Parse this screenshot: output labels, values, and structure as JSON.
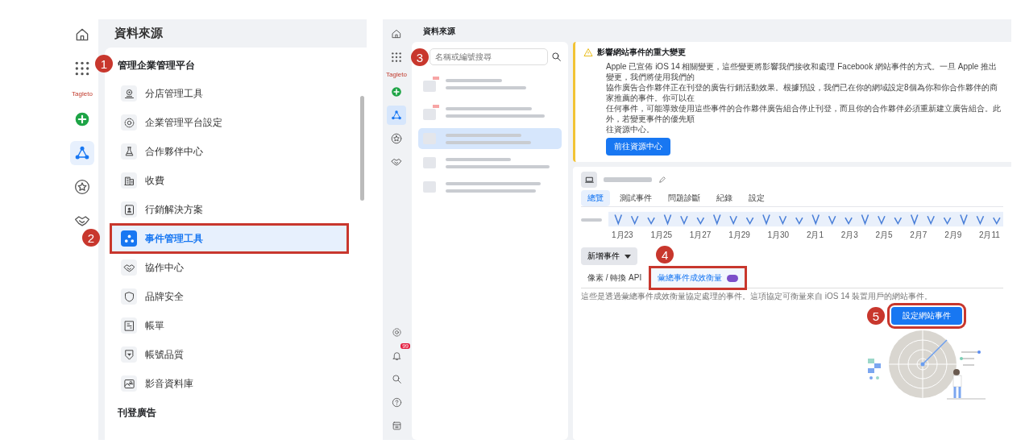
{
  "left_screenshot": {
    "title": "資料來源",
    "rail": [
      {
        "kind": "icon",
        "selected": false
      },
      {
        "kind": "icon",
        "selected": false
      },
      {
        "kind": "logo",
        "text": "Tagleto"
      },
      {
        "kind": "icon",
        "selected": false
      },
      {
        "kind": "icon",
        "selected": true
      },
      {
        "kind": "icon",
        "selected": false
      },
      {
        "kind": "icon",
        "selected": false
      }
    ],
    "menu": {
      "heading": "管理企業管理平台",
      "heading_marker": "1",
      "items": [
        {
          "label": "分店管理工具",
          "selected": false,
          "highlighted": false
        },
        {
          "label": "企業管理平台設定",
          "selected": false,
          "highlighted": false
        },
        {
          "label": "合作夥伴中心",
          "selected": false,
          "highlighted": false
        },
        {
          "label": "收費",
          "selected": false,
          "highlighted": false
        },
        {
          "label": "行銷解決方案",
          "selected": false,
          "highlighted": false
        },
        {
          "label": "事件管理工具",
          "selected": true,
          "highlighted": true,
          "marker": "2"
        },
        {
          "label": "協作中心",
          "selected": false,
          "highlighted": false
        },
        {
          "label": "品牌安全",
          "selected": false,
          "highlighted": false
        },
        {
          "label": "帳單",
          "selected": false,
          "highlighted": false
        },
        {
          "label": "帳號品質",
          "selected": false,
          "highlighted": false
        },
        {
          "label": "影音資料庫",
          "selected": false,
          "highlighted": false
        }
      ],
      "section": "刊登廣告"
    }
  },
  "right_screenshot": {
    "title": "資料來源",
    "rail": [
      {
        "kind": "icon",
        "selected": false
      },
      {
        "kind": "icon",
        "selected": false
      },
      {
        "kind": "logo",
        "text": "Tagleto"
      },
      {
        "kind": "icon",
        "selected": false
      },
      {
        "kind": "icon",
        "selected": true
      },
      {
        "kind": "icon",
        "selected": false
      },
      {
        "kind": "icon",
        "selected": false
      }
    ],
    "rail_bottom": [
      {
        "kind": "icon"
      },
      {
        "kind": "icon",
        "badge": "99"
      },
      {
        "kind": "icon"
      },
      {
        "kind": "icon"
      },
      {
        "kind": "icon"
      }
    ],
    "source_list": {
      "search": {
        "placeholder": "名稱或編號搜尋",
        "marker": "3"
      },
      "items": [
        {
          "selected": false,
          "flagged": true
        },
        {
          "selected": false,
          "flagged": true
        },
        {
          "selected": true,
          "flagged": false
        },
        {
          "selected": false,
          "flagged": false
        },
        {
          "selected": false,
          "flagged": false
        }
      ]
    },
    "alert": {
      "title": "影響網站事件的重大變更",
      "lines": [
        "Apple 已宣佈 iOS 14 相關變更，這些變更將影響我們接收和處理 Facebook 網站事件的方式。一旦 Apple 推出變更，我們將使用我們的",
        "協作廣告合作夥伴正在刊登的廣告行銷活動效果。根據預設，我們已在你的網域設定8個為你和你合作夥伴的商家推薦的事件。你可以在",
        "任何事件，可能導致使用這些事件的合作夥伴廣告組合停止刊登，而且你的合作夥伴必須重新建立廣告組合。此外，若變更事件的優先順",
        "往資源中心。"
      ],
      "button": "前往資源中心"
    },
    "dataset": {
      "tabs": [
        {
          "label": "總覽",
          "selected": true
        },
        {
          "label": "測試事件",
          "selected": false
        },
        {
          "label": "問題診斷",
          "selected": false
        },
        {
          "label": "紀錄",
          "selected": false
        },
        {
          "label": "設定",
          "selected": false
        }
      ],
      "chart_dates": [
        "1月23",
        "1月25",
        "1月27",
        "1月29",
        "1月30",
        "2月1",
        "2月3",
        "2月5",
        "2月7",
        "2月9",
        "2月11"
      ],
      "add_event": "新增事件",
      "subtabs": [
        {
          "label": "像素 / 轉換 API",
          "selected": false,
          "highlighted": false,
          "badge": false
        },
        {
          "label": "彙總事件成效衡量",
          "selected": true,
          "highlighted": true,
          "badge": true,
          "marker": "4"
        }
      ],
      "description": "這些是透過彙總事件成效衡量協定處理的事件。這項協定可衡量來自 iOS 14 裝置用戶的網站事件。",
      "setup_button": {
        "label": "設定網站事件",
        "highlighted": true,
        "marker": "5"
      }
    }
  }
}
